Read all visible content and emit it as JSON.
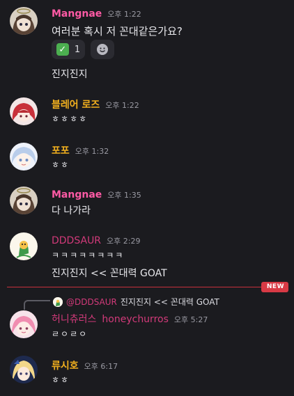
{
  "messages": [
    {
      "author": "Mangnae",
      "author_color": "#ff5aa5",
      "timestamp": "오후 1:22",
      "lines": [
        "여러분 혹시 저 꼰대같은가요?"
      ],
      "reaction": {
        "icon": "checkmark-emoji",
        "count": "1"
      },
      "add_reaction_icon": "smiley-icon",
      "followup": "진지진지"
    },
    {
      "author": "블레어 로즈",
      "author_color": "#f2b01e",
      "timestamp": "오후 1:22",
      "lines": [
        "ㅎㅎㅎㅎ"
      ]
    },
    {
      "author": "포포",
      "author_color": "#f2b01e",
      "timestamp": "오후 1:32",
      "lines": [
        "ㅎㅎ"
      ]
    },
    {
      "author": "Mangnae",
      "author_color": "#ff5aa5",
      "timestamp": "오후 1:35",
      "lines": [
        "다 나가라"
      ]
    },
    {
      "author": "DDDSAUR",
      "author_color": "#d23a7a",
      "timestamp": "오후 2:29",
      "lines": [
        "ㅋㅋㅋㅋㅋㅋㅋㅋ",
        "진지진지 << 꼰대력 GOAT"
      ]
    }
  ],
  "new_divider": {
    "label": "NEW",
    "color": "#d83a45"
  },
  "reply_message": {
    "reply_to": {
      "mention": "@DDDSAUR",
      "text": "진지진지 << 꼰대력 GOAT"
    },
    "author": "허니츄러스",
    "username": "honeychurros",
    "author_color": "#d23a7a",
    "timestamp": "오후 5:27",
    "lines": [
      "ㄹㅇㄹㅇ"
    ]
  },
  "last_message": {
    "author": "류시호",
    "author_color": "#f2b01e",
    "timestamp": "오후 6:17",
    "lines": [
      "ㅎㅎ"
    ]
  }
}
